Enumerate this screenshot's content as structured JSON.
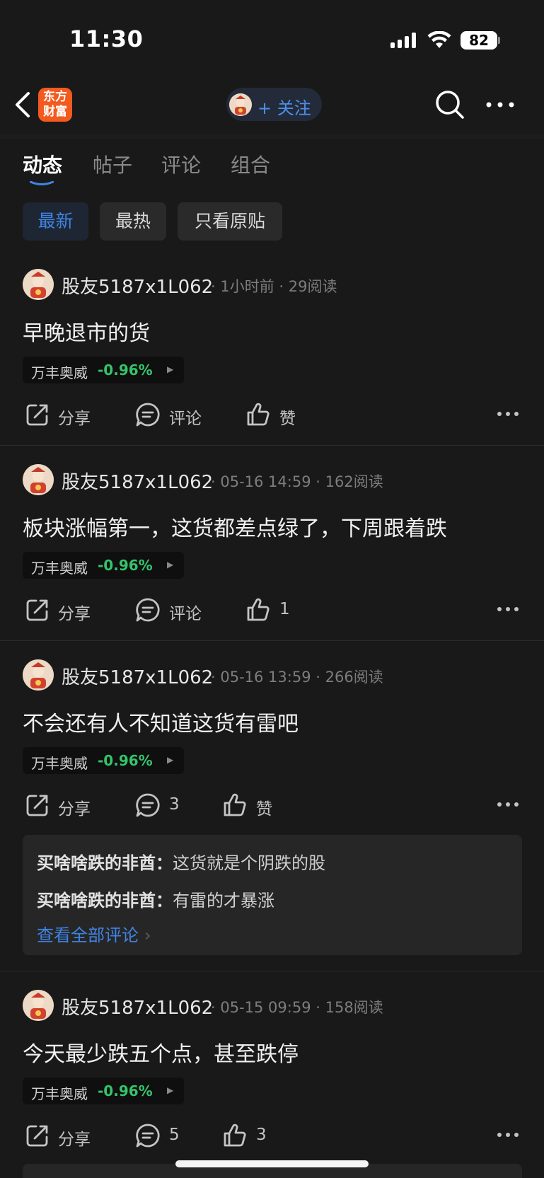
{
  "status_bar": {
    "time": "11:30",
    "battery": "82"
  },
  "header": {
    "logo_line1": "东方",
    "logo_line2": "财富",
    "follow_label": "+ 关注"
  },
  "tabs": [
    {
      "label": "动态"
    },
    {
      "label": "帖子"
    },
    {
      "label": "评论"
    },
    {
      "label": "组合"
    }
  ],
  "filters": [
    {
      "label": "最新"
    },
    {
      "label": "最热"
    },
    {
      "label": "只看原贴"
    }
  ],
  "accent_color": "#3f84e5",
  "down_color": "#35c46b",
  "posts": [
    {
      "author": "股友5187x1L062",
      "time": "1小时前",
      "reads": "29阅读",
      "text": "早晚退市的货",
      "stock": {
        "name": "万丰奥威",
        "change": "-0.96%"
      },
      "share": "分享",
      "comment": "评论",
      "like": "赞"
    },
    {
      "author": "股友5187x1L062",
      "time": "05-16 14:59",
      "reads": "162阅读",
      "text": "板块涨幅第一，这货都差点绿了，下周跟着跌",
      "stock": {
        "name": "万丰奥威",
        "change": "-0.96%"
      },
      "share": "分享",
      "comment": "评论",
      "like": "1"
    },
    {
      "author": "股友5187x1L062",
      "time": "05-16 13:59",
      "reads": "266阅读",
      "text": "不会还有人不知道这货有雷吧",
      "stock": {
        "name": "万丰奥威",
        "change": "-0.96%"
      },
      "share": "分享",
      "comment": "3",
      "like": "赞",
      "comments": [
        {
          "user": "买啥啥跌的非酋：",
          "text": "这货就是个阴跌的股"
        },
        {
          "user": "买啥啥跌的非酋：",
          "text": "有雷的才暴涨"
        }
      ],
      "view_all": "查看全部评论"
    },
    {
      "author": "股友5187x1L062",
      "time": "05-15 09:59",
      "reads": "158阅读",
      "text": "今天最少跌五个点，甚至跌停",
      "stock": {
        "name": "万丰奥威",
        "change": "-0.96%"
      },
      "share": "分享",
      "comment": "5",
      "like": "3"
    }
  ]
}
